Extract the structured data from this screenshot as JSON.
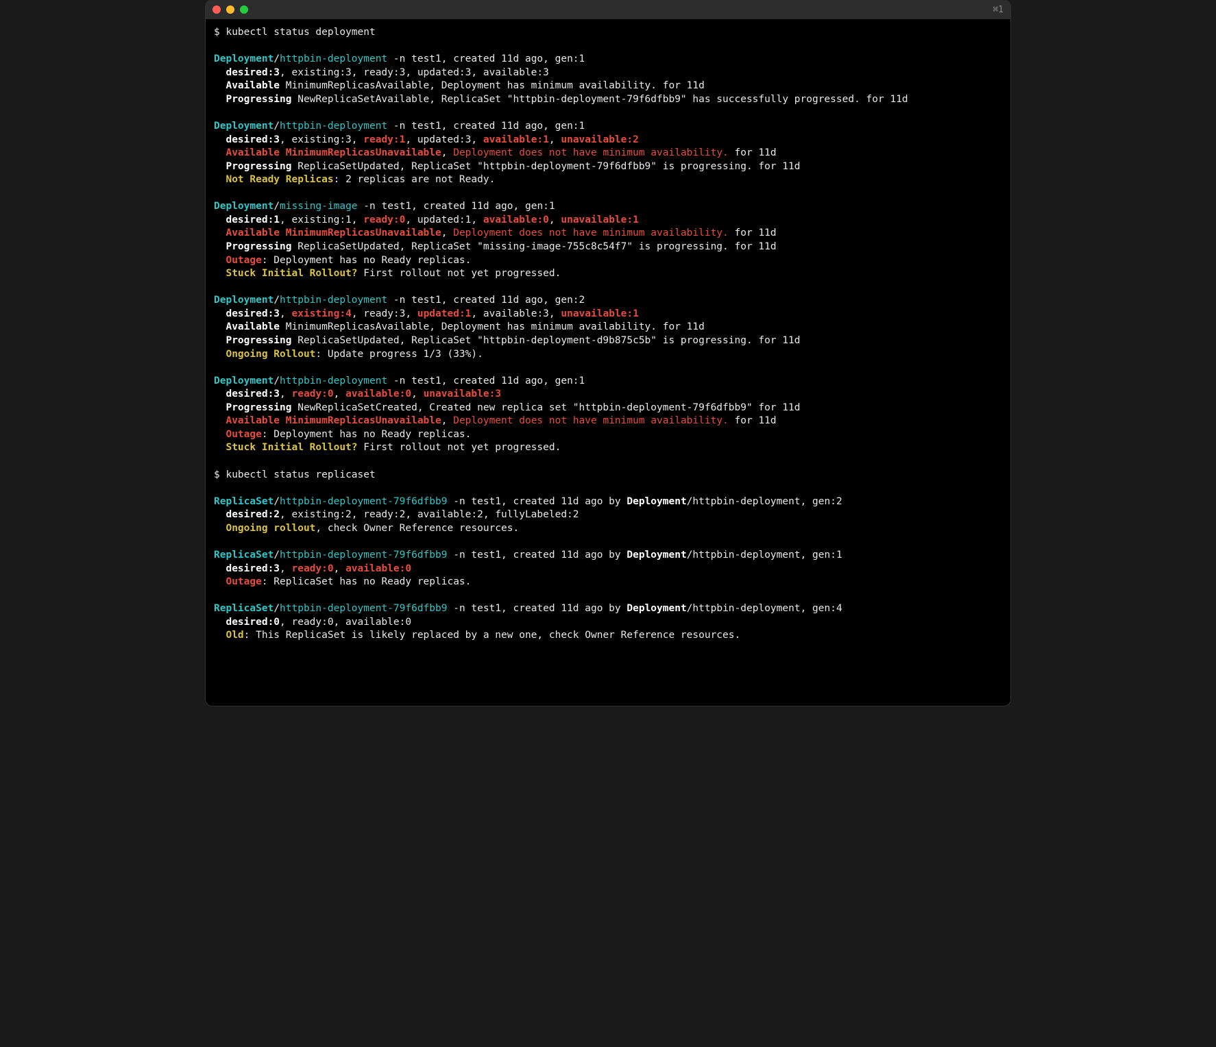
{
  "titlebar": {
    "right": "⌘1"
  },
  "colors": {
    "cyan": "#2ec6c6",
    "red": "#e74c3c",
    "yellow": "#d9c244",
    "fg": "#e8e8e8"
  },
  "lines": [
    [
      {
        "t": "$ ",
        "cls": "c-white"
      },
      {
        "t": "kubectl status deployment",
        "cls": "c-white"
      }
    ],
    [],
    [
      {
        "t": "Deployment",
        "cls": "c-cyan-b"
      },
      {
        "t": "/",
        "cls": "c-white"
      },
      {
        "t": "httpbin-deployment",
        "cls": "c-cyan"
      },
      {
        "t": " -n test1, created 11d ago, gen:1",
        "cls": "c-white"
      }
    ],
    [
      {
        "t": "  desired:3",
        "cls": "c-white-b"
      },
      {
        "t": ", existing:3, ready:3, updated:3, available:3",
        "cls": "c-white"
      }
    ],
    [
      {
        "t": "  Available ",
        "cls": "c-white-b"
      },
      {
        "t": "MinimumReplicasAvailable, Deployment has minimum availability. for 11d",
        "cls": "c-white"
      }
    ],
    [
      {
        "t": "  Progressing ",
        "cls": "c-white-b"
      },
      {
        "t": "NewReplicaSetAvailable, ReplicaSet \"httpbin-deployment-79f6dfbb9\" has successfully progressed. for 11d",
        "cls": "c-white"
      }
    ],
    [],
    [
      {
        "t": "Deployment",
        "cls": "c-cyan-b"
      },
      {
        "t": "/",
        "cls": "c-white"
      },
      {
        "t": "httpbin-deployment",
        "cls": "c-cyan"
      },
      {
        "t": " -n test1, created 11d ago, gen:1",
        "cls": "c-white"
      }
    ],
    [
      {
        "t": "  desired:3",
        "cls": "c-white-b"
      },
      {
        "t": ", existing:3, ",
        "cls": "c-white"
      },
      {
        "t": "ready:1",
        "cls": "c-red-b"
      },
      {
        "t": ", updated:3, ",
        "cls": "c-white"
      },
      {
        "t": "available:1",
        "cls": "c-red-b"
      },
      {
        "t": ", ",
        "cls": "c-white"
      },
      {
        "t": "unavailable:2",
        "cls": "c-red-b"
      }
    ],
    [
      {
        "t": "  Available ",
        "cls": "c-red-b"
      },
      {
        "t": "MinimumReplicasUnavailable",
        "cls": "c-red-b"
      },
      {
        "t": ", ",
        "cls": "c-white"
      },
      {
        "t": "Deployment does not have minimum availability.",
        "cls": "c-red"
      },
      {
        "t": " for 11d",
        "cls": "c-white"
      }
    ],
    [
      {
        "t": "  Progressing ",
        "cls": "c-white-b"
      },
      {
        "t": "ReplicaSetUpdated, ReplicaSet \"httpbin-deployment-79f6dfbb9\" is progressing. for 11d",
        "cls": "c-white"
      }
    ],
    [
      {
        "t": "  Not Ready Replicas",
        "cls": "c-yellow-b"
      },
      {
        "t": ": 2 replicas are not Ready.",
        "cls": "c-white"
      }
    ],
    [],
    [
      {
        "t": "Deployment",
        "cls": "c-cyan-b"
      },
      {
        "t": "/",
        "cls": "c-white"
      },
      {
        "t": "missing-image",
        "cls": "c-cyan"
      },
      {
        "t": " -n test1, created 11d ago, gen:1",
        "cls": "c-white"
      }
    ],
    [
      {
        "t": "  desired:1",
        "cls": "c-white-b"
      },
      {
        "t": ", existing:1, ",
        "cls": "c-white"
      },
      {
        "t": "ready:0",
        "cls": "c-red-b"
      },
      {
        "t": ", updated:1, ",
        "cls": "c-white"
      },
      {
        "t": "available:0",
        "cls": "c-red-b"
      },
      {
        "t": ", ",
        "cls": "c-white"
      },
      {
        "t": "unavailable:1",
        "cls": "c-red-b"
      }
    ],
    [
      {
        "t": "  Available ",
        "cls": "c-red-b"
      },
      {
        "t": "MinimumReplicasUnavailable",
        "cls": "c-red-b"
      },
      {
        "t": ", ",
        "cls": "c-white"
      },
      {
        "t": "Deployment does not have minimum availability.",
        "cls": "c-red"
      },
      {
        "t": " for 11d",
        "cls": "c-white"
      }
    ],
    [
      {
        "t": "  Progressing ",
        "cls": "c-white-b"
      },
      {
        "t": "ReplicaSetUpdated, ReplicaSet \"missing-image-755c8c54f7\" is progressing. for 11d",
        "cls": "c-white"
      }
    ],
    [
      {
        "t": "  Outage",
        "cls": "c-red-b"
      },
      {
        "t": ": Deployment has no Ready replicas.",
        "cls": "c-white"
      }
    ],
    [
      {
        "t": "  Stuck Initial Rollout?",
        "cls": "c-yellow-b"
      },
      {
        "t": " First rollout not yet progressed.",
        "cls": "c-white"
      }
    ],
    [],
    [
      {
        "t": "Deployment",
        "cls": "c-cyan-b"
      },
      {
        "t": "/",
        "cls": "c-white"
      },
      {
        "t": "httpbin-deployment",
        "cls": "c-cyan"
      },
      {
        "t": " -n test1, created 11d ago, gen:2",
        "cls": "c-white"
      }
    ],
    [
      {
        "t": "  desired:3",
        "cls": "c-white-b"
      },
      {
        "t": ", ",
        "cls": "c-white"
      },
      {
        "t": "existing:4",
        "cls": "c-red-b"
      },
      {
        "t": ", ready:3, ",
        "cls": "c-white"
      },
      {
        "t": "updated:1",
        "cls": "c-red-b"
      },
      {
        "t": ", available:3, ",
        "cls": "c-white"
      },
      {
        "t": "unavailable:1",
        "cls": "c-red-b"
      }
    ],
    [
      {
        "t": "  Available ",
        "cls": "c-white-b"
      },
      {
        "t": "MinimumReplicasAvailable, Deployment has minimum availability. for 11d",
        "cls": "c-white"
      }
    ],
    [
      {
        "t": "  Progressing ",
        "cls": "c-white-b"
      },
      {
        "t": "ReplicaSetUpdated, ReplicaSet \"httpbin-deployment-d9b875c5b\" is progressing. for 11d",
        "cls": "c-white"
      }
    ],
    [
      {
        "t": "  Ongoing Rollout",
        "cls": "c-yellow-b"
      },
      {
        "t": ": Update progress 1/3 (33%).",
        "cls": "c-white"
      }
    ],
    [],
    [
      {
        "t": "Deployment",
        "cls": "c-cyan-b"
      },
      {
        "t": "/",
        "cls": "c-white"
      },
      {
        "t": "httpbin-deployment",
        "cls": "c-cyan"
      },
      {
        "t": " -n test1, created 11d ago, gen:1",
        "cls": "c-white"
      }
    ],
    [
      {
        "t": "  desired:3",
        "cls": "c-white-b"
      },
      {
        "t": ", ",
        "cls": "c-white"
      },
      {
        "t": "ready:0",
        "cls": "c-red-b"
      },
      {
        "t": ", ",
        "cls": "c-white"
      },
      {
        "t": "available:0",
        "cls": "c-red-b"
      },
      {
        "t": ", ",
        "cls": "c-white"
      },
      {
        "t": "unavailable:3",
        "cls": "c-red-b"
      }
    ],
    [
      {
        "t": "  Progressing ",
        "cls": "c-white-b"
      },
      {
        "t": "NewReplicaSetCreated, Created new replica set \"httpbin-deployment-79f6dfbb9\" for 11d",
        "cls": "c-white"
      }
    ],
    [
      {
        "t": "  Available ",
        "cls": "c-red-b"
      },
      {
        "t": "MinimumReplicasUnavailable",
        "cls": "c-red-b"
      },
      {
        "t": ", ",
        "cls": "c-white"
      },
      {
        "t": "Deployment does not have minimum availability.",
        "cls": "c-red"
      },
      {
        "t": " for 11d",
        "cls": "c-white"
      }
    ],
    [
      {
        "t": "  Outage",
        "cls": "c-red-b"
      },
      {
        "t": ": Deployment has no Ready replicas.",
        "cls": "c-white"
      }
    ],
    [
      {
        "t": "  Stuck Initial Rollout?",
        "cls": "c-yellow-b"
      },
      {
        "t": " First rollout not yet progressed.",
        "cls": "c-white"
      }
    ],
    [],
    [
      {
        "t": "$ ",
        "cls": "c-white"
      },
      {
        "t": "kubectl status replicaset",
        "cls": "c-white"
      }
    ],
    [],
    [
      {
        "t": "ReplicaSet",
        "cls": "c-cyan-b"
      },
      {
        "t": "/",
        "cls": "c-white"
      },
      {
        "t": "httpbin-deployment-79f6dfbb9",
        "cls": "c-cyan"
      },
      {
        "t": " -n test1, created 11d ago by ",
        "cls": "c-white"
      },
      {
        "t": "Deployment",
        "cls": "c-white-b"
      },
      {
        "t": "/httpbin-deployment, gen:2",
        "cls": "c-white"
      }
    ],
    [
      {
        "t": "  desired:2",
        "cls": "c-white-b"
      },
      {
        "t": ", existing:2, ready:2, available:2, fullyLabeled:2",
        "cls": "c-white"
      }
    ],
    [
      {
        "t": "  Ongoing rollout",
        "cls": "c-yellow-b"
      },
      {
        "t": ", check Owner Reference resources.",
        "cls": "c-white"
      }
    ],
    [],
    [
      {
        "t": "ReplicaSet",
        "cls": "c-cyan-b"
      },
      {
        "t": "/",
        "cls": "c-white"
      },
      {
        "t": "httpbin-deployment-79f6dfbb9",
        "cls": "c-cyan"
      },
      {
        "t": " -n test1, created 11d ago by ",
        "cls": "c-white"
      },
      {
        "t": "Deployment",
        "cls": "c-white-b"
      },
      {
        "t": "/httpbin-deployment, gen:1",
        "cls": "c-white"
      }
    ],
    [
      {
        "t": "  desired:3",
        "cls": "c-white-b"
      },
      {
        "t": ", ",
        "cls": "c-white"
      },
      {
        "t": "ready:0",
        "cls": "c-red-b"
      },
      {
        "t": ", ",
        "cls": "c-white"
      },
      {
        "t": "available:0",
        "cls": "c-red-b"
      }
    ],
    [
      {
        "t": "  Outage",
        "cls": "c-red-b"
      },
      {
        "t": ": ReplicaSet has no Ready replicas.",
        "cls": "c-white"
      }
    ],
    [],
    [
      {
        "t": "ReplicaSet",
        "cls": "c-cyan-b"
      },
      {
        "t": "/",
        "cls": "c-white"
      },
      {
        "t": "httpbin-deployment-79f6dfbb9",
        "cls": "c-cyan"
      },
      {
        "t": " -n test1, created 11d ago by ",
        "cls": "c-white"
      },
      {
        "t": "Deployment",
        "cls": "c-white-b"
      },
      {
        "t": "/httpbin-deployment, gen:4",
        "cls": "c-white"
      }
    ],
    [
      {
        "t": "  desired:0",
        "cls": "c-white-b"
      },
      {
        "t": ", ready:0, available:0",
        "cls": "c-white"
      }
    ],
    [
      {
        "t": "  Old",
        "cls": "c-yellow-b"
      },
      {
        "t": ": This ReplicaSet is likely replaced by a new one, check Owner Reference resources.",
        "cls": "c-white"
      }
    ]
  ]
}
